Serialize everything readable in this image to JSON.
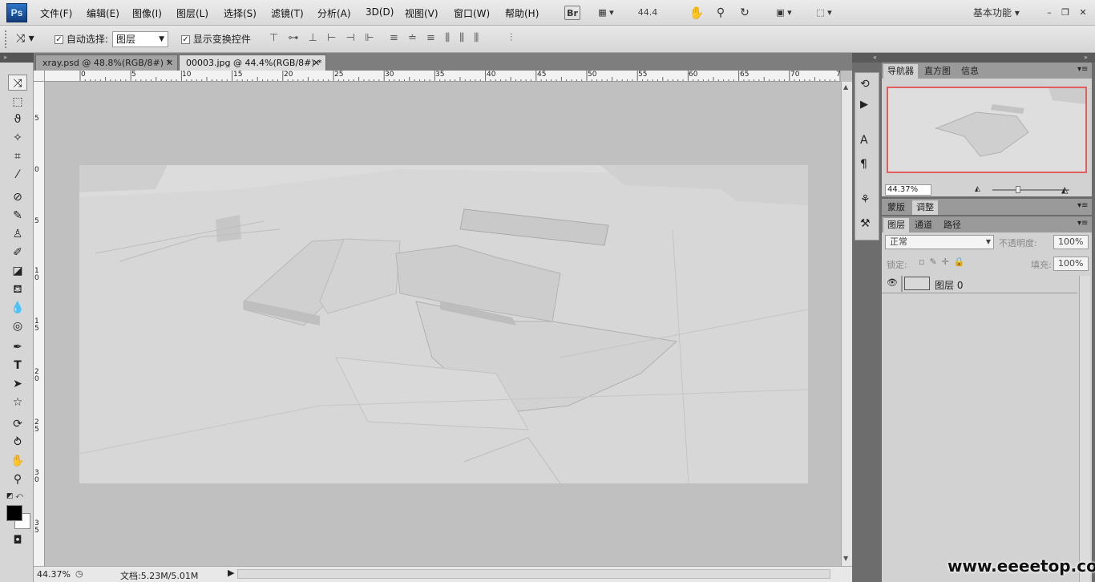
{
  "app": {
    "logo": "Ps",
    "workspace": "基本功能",
    "zoom_box": "44.4"
  },
  "menu": [
    "文件(F)",
    "编辑(E)",
    "图像(I)",
    "图层(L)",
    "选择(S)",
    "滤镜(T)",
    "分析(A)",
    "3D(D)",
    "视图(V)",
    "窗口(W)",
    "帮助(H)"
  ],
  "toolbar": {
    "bridge": "Br"
  },
  "options": {
    "auto_select_label": "自动选择:",
    "auto_select_checked": "✓",
    "auto_select_value": "图层",
    "show_transform_label": "显示变换控件",
    "show_transform_checked": "✓"
  },
  "tabs": [
    {
      "label": "xray.psd @ 48.8%(RGB/8#) *",
      "close": "✕"
    },
    {
      "label": "00003.jpg @ 44.4%(RGB/8#) *",
      "close": "✕"
    }
  ],
  "ruler": {
    "top_ticks": [
      "0",
      "5",
      "10",
      "15",
      "20",
      "25",
      "30",
      "35",
      "40",
      "45",
      "50",
      "55",
      "60",
      "65",
      "70",
      "7"
    ],
    "left_ticks": [
      "5",
      "0",
      "5",
      "1 0",
      "1 5",
      "2 0",
      "2 5",
      "3 0",
      "3 5"
    ]
  },
  "status": {
    "zoom": "44.37%",
    "doc": "文档:5.23M/5.01M"
  },
  "navigator": {
    "tabs": [
      "导航器",
      "直方图",
      "信息"
    ],
    "zoom": "44.37%"
  },
  "adjust_panel": {
    "tabs": [
      "蒙版",
      "调整"
    ]
  },
  "layers_panel": {
    "tabs": [
      "图层",
      "通道",
      "路径"
    ],
    "blend_mode": "正常",
    "opacity_label": "不透明度:",
    "opacity_value": "100%",
    "lock_label": "锁定:",
    "fill_label": "填充:",
    "fill_value": "100%",
    "layer_name": "图层 0"
  },
  "watermark": "www.eeeetop.com"
}
